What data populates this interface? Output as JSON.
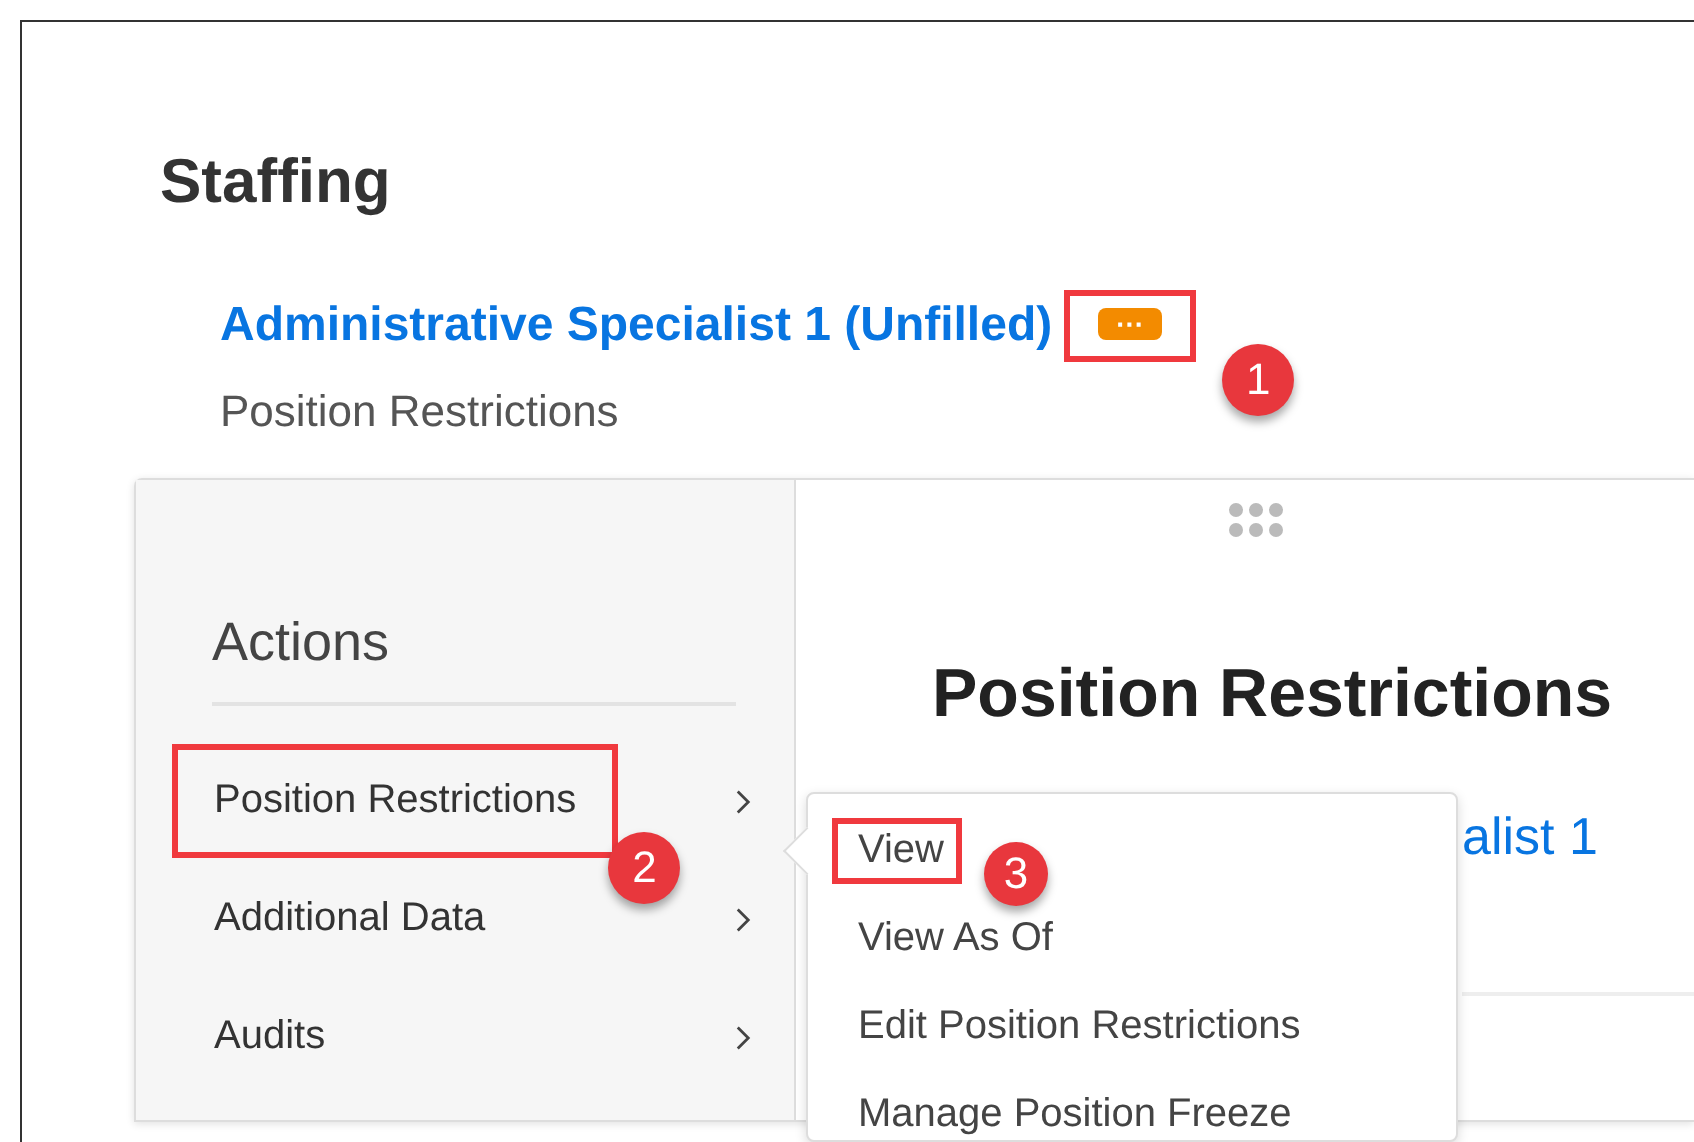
{
  "page": {
    "title": "Staffing"
  },
  "position": {
    "name": "Administrative Specialist 1 (Unfilled)",
    "more_button": {
      "label": "···",
      "annotation": "1"
    },
    "subtitle": "Position Restrictions"
  },
  "actions_panel": {
    "title": "Actions",
    "items": [
      {
        "label": "Position Restrictions",
        "highlighted": true,
        "annotation": "2"
      },
      {
        "label": "Additional Data",
        "highlighted": false
      },
      {
        "label": "Audits",
        "highlighted": false
      }
    ]
  },
  "content": {
    "title": "Position Restrictions",
    "link": "alist 1"
  },
  "submenu": {
    "items": [
      {
        "label": "View",
        "highlighted": true,
        "annotation": "3"
      },
      {
        "label": "View As Of",
        "highlighted": false
      },
      {
        "label": "Edit Position Restrictions",
        "highlighted": false
      },
      {
        "label": "Manage Position Freeze",
        "highlighted": false
      }
    ]
  }
}
